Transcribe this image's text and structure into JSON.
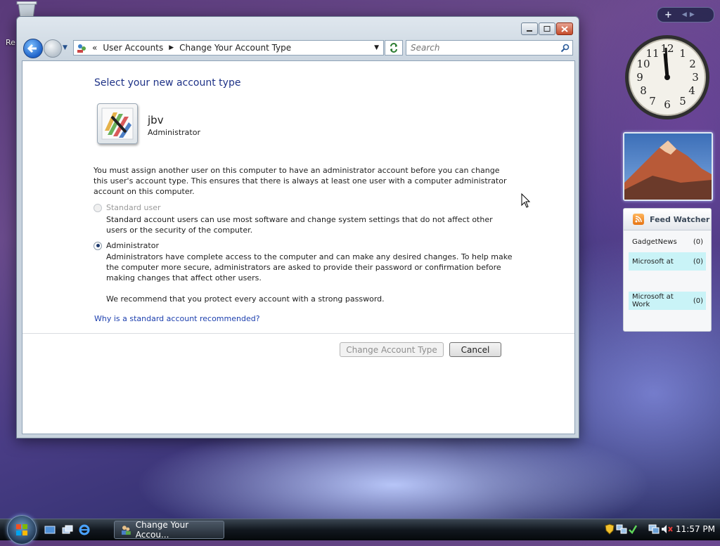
{
  "window": {
    "breadcrumb": [
      "User Accounts",
      "Change Your Account Type"
    ],
    "search_placeholder": "Search"
  },
  "page": {
    "heading": "Select your new account type",
    "user": {
      "name": "jbv",
      "role": "Administrator"
    },
    "notice": "You must assign another user on this computer to have an administrator account before you can change this user's account type. This ensures that there is always at least one user with a computer administrator account on this computer.",
    "options": [
      {
        "label": "Standard user",
        "description": "Standard account users can use most software and change system settings that do not affect other users or the security of the computer.",
        "selected": false,
        "disabled": true
      },
      {
        "label": "Administrator",
        "description": "Administrators have complete access to the computer and can make any desired changes. To help make the computer more secure, administrators are asked to provide their password or confirmation before making changes that affect other users.",
        "selected": true,
        "disabled": false
      }
    ],
    "recommendation": "We recommend that you protect every account with a strong password.",
    "help_link": "Why is a standard account recommended?",
    "buttons": {
      "change": "Change Account Type",
      "cancel": "Cancel"
    }
  },
  "desktop": {
    "icon_label": "Re"
  },
  "sidebar": {
    "feed": {
      "title": "Feed Watcher",
      "items": [
        {
          "name": "GadgetNews",
          "count": "(0)"
        },
        {
          "name": "Microsoft at",
          "count": "(0)"
        },
        {
          "name": "Microsoft at Work",
          "count": "(0)"
        }
      ]
    }
  },
  "taskbar": {
    "task_title": "Change Your Accou...",
    "clock": "11:57 PM"
  },
  "colors": {
    "link": "#1c3fae",
    "heading": "#1e3287",
    "feed_highlight": "#c9f3f7"
  }
}
